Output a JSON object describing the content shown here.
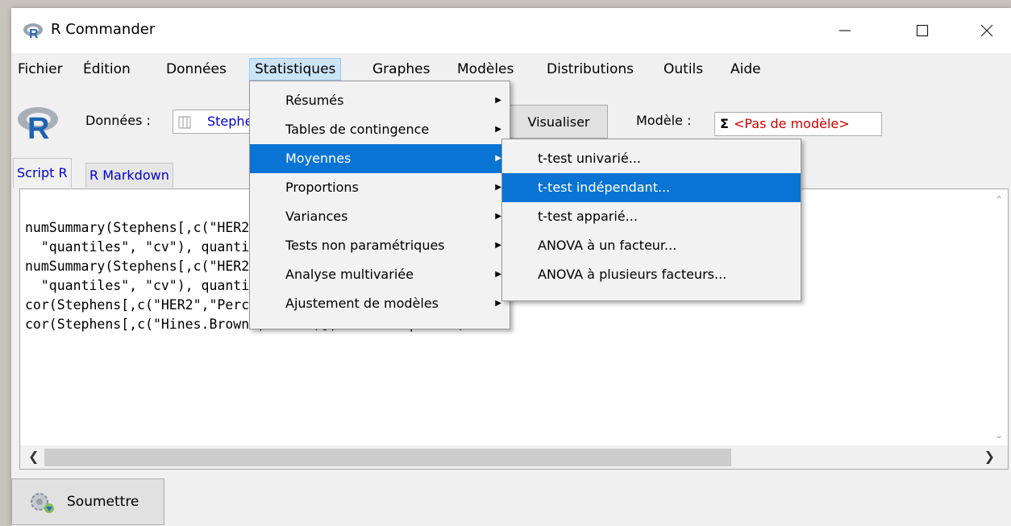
{
  "window": {
    "title": "R Commander"
  },
  "menubar": {
    "items": [
      "Fichier",
      "Édition",
      "Données",
      "Statistiques",
      "Graphes",
      "Modèles",
      "Distributions",
      "Outils",
      "Aide"
    ],
    "active": "Statistiques"
  },
  "toolbar": {
    "dataset_label": "Données :",
    "dataset_name": "Stephens",
    "visualiser_label": "Visualiser",
    "model_label": "Modèle :",
    "model_symbol": "Σ",
    "model_name": "<Pas de modèle>"
  },
  "tabs": [
    "Script R",
    "R Markdown"
  ],
  "script": {
    "lines": [
      "numSummary(Stephens[,c(\"HER2\",\"Perception\",\"Peur\")], groups=Stephens$Condition, stat",
      "  \"quantiles\", \"cv\"), quantiles=c(0,.25,.5,.75,1))",
      "numSummary(Stephens[,c(\"HER2\",\"Perception\",\"Peur\")], groups=Stephens$Genre, statistic",
      "  \"quantiles\", \"cv\"), quantiles=c(0,.25,.5,.75,1))",
      "cor(Stephens[,c(\"HER2\",\"Perception\")], use=\"complete\")",
      "cor(Stephens[,c(\"Hines.Brown\",\"Peur\")], use=\"complete\")"
    ]
  },
  "stats_menu": {
    "items": [
      {
        "label": "Résumés",
        "submenu": true
      },
      {
        "label": "Tables de contingence",
        "submenu": true
      },
      {
        "label": "Moyennes",
        "submenu": true,
        "highlighted": true
      },
      {
        "label": "Proportions",
        "submenu": true
      },
      {
        "label": "Variances",
        "submenu": true
      },
      {
        "label": "Tests non paramétriques",
        "submenu": true
      },
      {
        "label": "Analyse multivariée",
        "submenu": true
      },
      {
        "label": "Ajustement de modèles",
        "submenu": true
      }
    ]
  },
  "means_submenu": {
    "items": [
      {
        "label": "t-test univarié..."
      },
      {
        "label": "t-test indépendant...",
        "highlighted": true
      },
      {
        "label": "t-test apparié..."
      },
      {
        "label": "ANOVA à un facteur..."
      },
      {
        "label": "ANOVA à plusieurs facteurs..."
      }
    ]
  },
  "footer": {
    "submit_label": "Soumettre"
  },
  "colors": {
    "highlight": "#0a74d4",
    "dataset_text": "#0000cc",
    "model_text": "#cc0000",
    "menu_active_bg": "#cce4f7"
  }
}
